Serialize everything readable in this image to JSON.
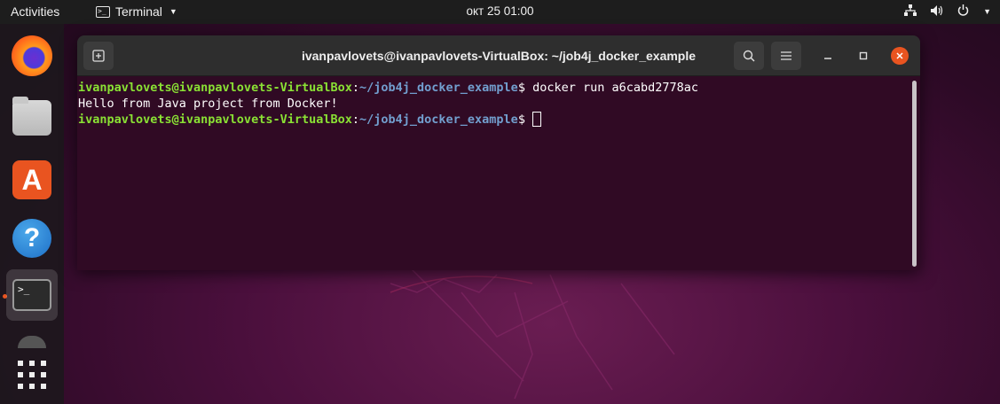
{
  "topbar": {
    "activities": "Activities",
    "app_name": "Terminal",
    "clock": "окт 25  01:00",
    "tray_icons": [
      "network-icon",
      "volume-icon",
      "power-icon",
      "menu-caret-icon"
    ]
  },
  "dock": {
    "items": [
      "firefox",
      "files",
      "ubuntu-software",
      "help",
      "terminal",
      "trash",
      "show-applications"
    ],
    "accent": "#e95420"
  },
  "window": {
    "title": "ivanpavlovets@ivanpavlovets-VirtualBox: ~/job4j_docker_example"
  },
  "terminal": {
    "user_host": "ivanpavlovets@ivanpavlovets-VirtualBox",
    "path": "~/job4j_docker_example",
    "line1_cmd": " docker run a6cabd2778ac",
    "output": "Hello from Java project from Docker!",
    "colors": {
      "background": "#300a24",
      "user": "#8ae234",
      "path": "#729fcf"
    }
  }
}
